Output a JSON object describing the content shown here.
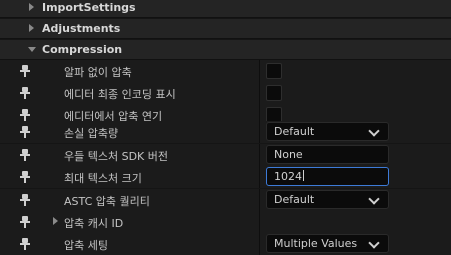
{
  "sections": {
    "import_settings": "ImportSettings",
    "adjustments": "Adjustments",
    "compression": "Compression"
  },
  "properties": {
    "no_alpha": {
      "label": "알파 없이 압축",
      "checked": false
    },
    "show_editor_encoding": {
      "label": "에디터 최종 인코딩 표시",
      "checked": false
    },
    "defer_compression": {
      "label": "에디터에서 압축 연기",
      "checked": false
    },
    "lossy_compression": {
      "label": "손실 압축량",
      "value": "Default"
    },
    "oodle_sdk_version": {
      "label": "우들 텍스처 SDK 버전",
      "value": "None"
    },
    "max_texture_size": {
      "label": "최대 텍스처 크기",
      "value": "1024"
    },
    "astc_quality": {
      "label": "ASTC 압축 퀄리티",
      "value": "Default"
    },
    "compression_cache_id": {
      "label": "압축 캐시 ID"
    },
    "compression_settings": {
      "label": "압축 세팅",
      "value": "Multiple Values"
    }
  },
  "icons": {
    "pin": "pin-icon",
    "collapsed": "chevron-right-icon",
    "expanded": "chevron-down-icon"
  },
  "colors": {
    "background": "#151515",
    "focus_border": "#3d7bd8"
  }
}
